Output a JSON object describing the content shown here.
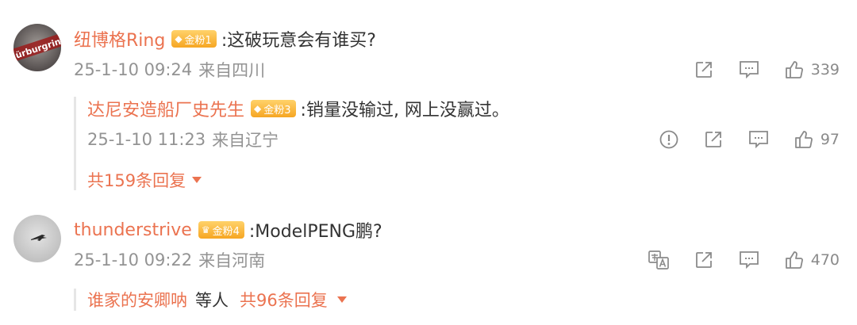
{
  "comments": [
    {
      "user": "纽博格Ring",
      "badge": "金粉1",
      "text": ":这破玩意会有谁买?",
      "time": "25-1-10 09:24",
      "location": "来自四川",
      "likes": "339",
      "avatar_text": "Nürburgring"
    },
    {
      "user": "thunderstrive",
      "badge": "金粉4",
      "text": ":ModelPENG鹏?",
      "time": "25-1-10 09:22",
      "location": "来自河南",
      "likes": "470"
    }
  ],
  "reply": {
    "user": "达尼安造船厂史先生",
    "badge": "金粉3",
    "text": ":销量没输过, 网上没赢过。",
    "time": "25-1-10 11:23",
    "location": "来自辽宁",
    "likes": "97",
    "more": "共159条回复"
  },
  "reply2": {
    "user": "谁家的安卿呐",
    "suffix": "等人",
    "more": "共96条回复"
  },
  "colors": {
    "accent": "#eb7350",
    "meta": "#939393",
    "badge": "#f6a623"
  }
}
